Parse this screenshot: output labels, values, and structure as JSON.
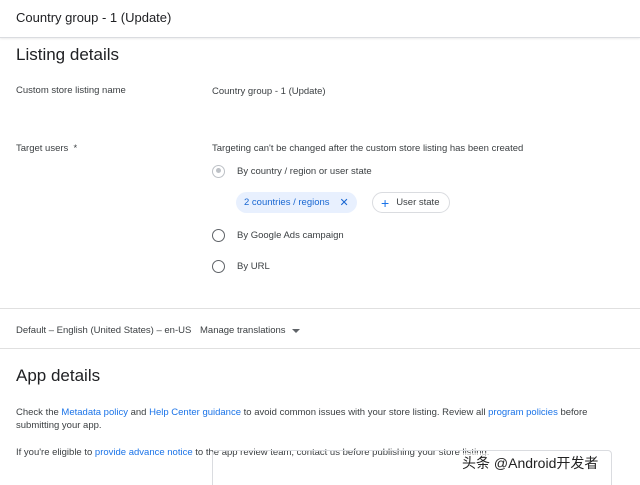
{
  "header": {
    "title": "Country group - 1 (Update)"
  },
  "listing": {
    "heading": "Listing details",
    "name_label": "Custom store listing name",
    "name_value": "Country group - 1 (Update)",
    "target_label": "Target users  *",
    "target_note": "Targeting can't be changed after the custom store listing has been created",
    "options": [
      {
        "label": "By country / region or user state",
        "checked": true
      },
      {
        "label": "By Google Ads campaign",
        "checked": false
      },
      {
        "label": "By URL",
        "checked": false
      }
    ],
    "chip_countries": "2 countries / regions",
    "chip_user_state": "User state"
  },
  "language": {
    "default": "Default – English (United States) – en-US",
    "manage": "Manage translations"
  },
  "app_details": {
    "heading": "App details",
    "p1_a": "Check the ",
    "p1_link1": "Metadata policy",
    "p1_b": " and ",
    "p1_link2": "Help Center guidance",
    "p1_c": " to avoid common issues with your store listing. Review all ",
    "p1_link3": "program policies",
    "p1_d": " before submitting your app.",
    "p2_a": "If you're eligible to ",
    "p2_link": "provide advance notice",
    "p2_b": " to the app review team, contact us before publishing your store listing."
  },
  "watermark": "头条 @Android开发者"
}
